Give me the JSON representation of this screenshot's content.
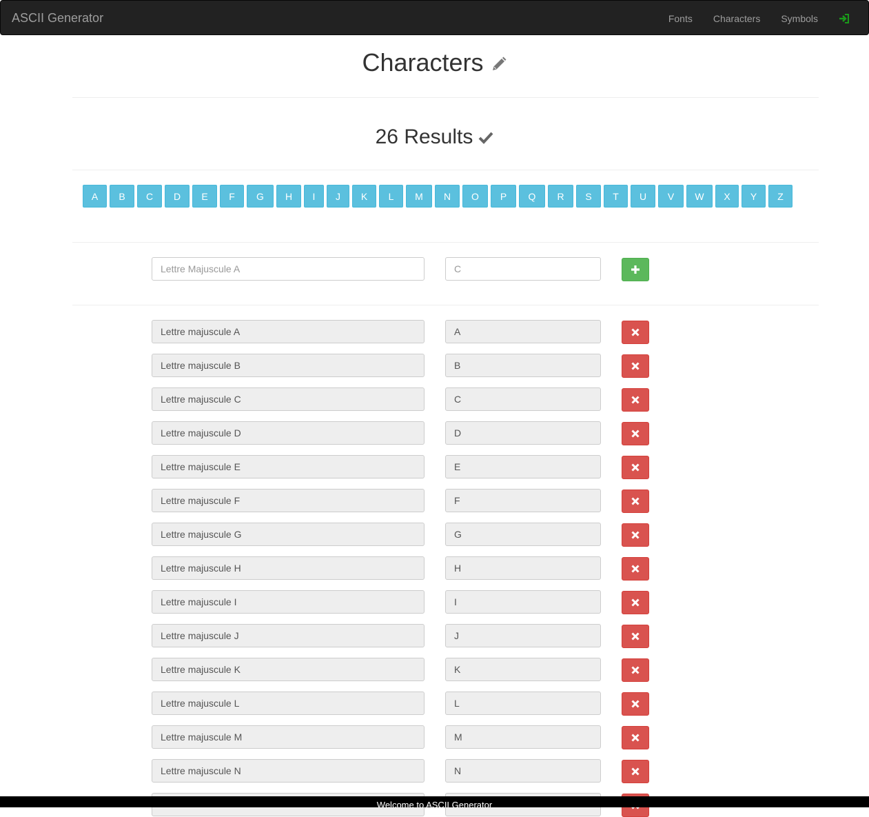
{
  "navbar": {
    "brand": "ASCII Generator",
    "links": [
      "Fonts",
      "Characters",
      "Symbols"
    ],
    "login_icon": "login-icon"
  },
  "header": {
    "title": "Characters",
    "edit_icon": "pencil-icon"
  },
  "results": {
    "text": "26 Results",
    "icon": "check-icon"
  },
  "letters": [
    "A",
    "B",
    "C",
    "D",
    "E",
    "F",
    "G",
    "H",
    "I",
    "J",
    "K",
    "L",
    "M",
    "N",
    "O",
    "P",
    "Q",
    "R",
    "S",
    "T",
    "U",
    "V",
    "W",
    "X",
    "Y",
    "Z"
  ],
  "new_entry": {
    "name_placeholder": "Lettre Majuscule A",
    "char_placeholder": "C",
    "add_icon": "plus-icon",
    "add_color": "#5cb85c"
  },
  "rows": [
    {
      "name": "Lettre majuscule A",
      "char": "A"
    },
    {
      "name": "Lettre majuscule B",
      "char": "B"
    },
    {
      "name": "Lettre majuscule C",
      "char": "C"
    },
    {
      "name": "Lettre majuscule D",
      "char": "D"
    },
    {
      "name": "Lettre majuscule E",
      "char": "E"
    },
    {
      "name": "Lettre majuscule F",
      "char": "F"
    },
    {
      "name": "Lettre majuscule G",
      "char": "G"
    },
    {
      "name": "Lettre majuscule H",
      "char": "H"
    },
    {
      "name": "Lettre majuscule I",
      "char": "I"
    },
    {
      "name": "Lettre majuscule J",
      "char": "J"
    },
    {
      "name": "Lettre majuscule K",
      "char": "K"
    },
    {
      "name": "Lettre majuscule L",
      "char": "L"
    },
    {
      "name": "Lettre majuscule M",
      "char": "M"
    },
    {
      "name": "Lettre majuscule N",
      "char": "N"
    },
    {
      "name": "",
      "char": ""
    }
  ],
  "delete_icon": "remove-icon",
  "delete_color": "#d9534f",
  "letter_color": "#5bc0de",
  "footer": {
    "text": "Welcome to ASCII Generator"
  }
}
